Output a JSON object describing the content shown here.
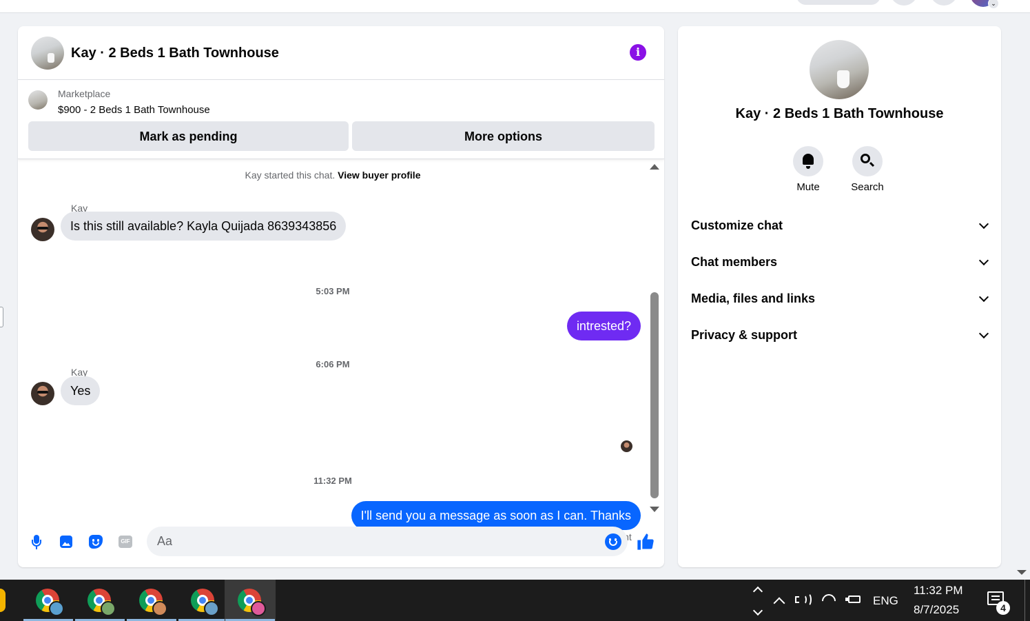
{
  "conversation": {
    "title": "Kay · 2 Beds 1 Bath Townhouse"
  },
  "listing": {
    "source": "Marketplace",
    "title": "$900 - 2 Beds 1 Bath Townhouse",
    "mark_pending_label": "Mark as pending",
    "more_options_label": "More options"
  },
  "messages": {
    "system_prefix": "Kay started this chat. ",
    "system_link": "View buyer profile",
    "items": [
      {
        "type": "incoming",
        "sender": "Kay",
        "text": "Is this still available? Kayla Quijada 8639343856"
      },
      {
        "type": "timestamp",
        "text": "5:03 PM"
      },
      {
        "type": "outgoing",
        "text": "intrested?"
      },
      {
        "type": "timestamp",
        "text": "6:06 PM"
      },
      {
        "type": "incoming",
        "sender": "Kay",
        "text": "Yes"
      },
      {
        "type": "timestamp",
        "text": "11:32 PM"
      },
      {
        "type": "outgoing",
        "text": "I'll send you a message as soon as I can. Thanks",
        "status": "Sent"
      }
    ]
  },
  "composer": {
    "placeholder": "Aa",
    "icons": [
      "microphone-icon",
      "photo-icon",
      "sticker-icon",
      "gif-icon",
      "emoji-icon",
      "thumbs-up-icon"
    ]
  },
  "details_panel": {
    "title": "Kay · 2 Beds 1 Bath Townhouse",
    "actions": [
      {
        "label": "Mute",
        "icon": "bell-icon"
      },
      {
        "label": "Search",
        "icon": "search-icon"
      }
    ],
    "sections": [
      {
        "label": "Customize chat"
      },
      {
        "label": "Chat members"
      },
      {
        "label": "Media, files and links"
      },
      {
        "label": "Privacy & support"
      }
    ]
  },
  "taskbar": {
    "language": "ENG",
    "time": "11:32 PM",
    "date": "8/7/2025",
    "notification_count": "4"
  },
  "colors": {
    "accent_purple": "#8a11e6",
    "bubble_outgoing_purple": "#6f2bf2",
    "bubble_outgoing_blue": "#0866ff",
    "bubble_incoming": "#e4e6eb",
    "messenger_blue": "#0866ff"
  }
}
